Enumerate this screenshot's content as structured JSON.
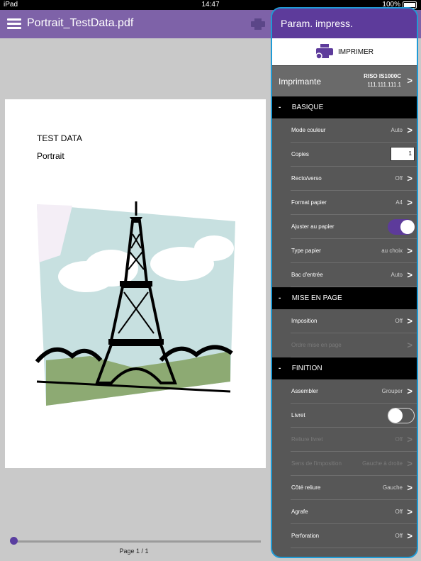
{
  "statusbar": {
    "device": "iPad",
    "time": "14:47",
    "battery": "100%"
  },
  "topbar": {
    "doc_title": "Portrait_TestData.pdf"
  },
  "viewer": {
    "line1": "TEST DATA",
    "line2": "Portrait",
    "page_count": "Page 1 / 1"
  },
  "panel": {
    "title": "Param. impress.",
    "print_label": "IMPRIMER",
    "printer": {
      "label": "Imprimante",
      "model": "RISO IS1000C",
      "ip": "111.111.111.1"
    },
    "sections": {
      "basic": "BASIQUE",
      "layout": "MISE EN PAGE",
      "finishing": "FINITION"
    },
    "rows": {
      "color_mode": {
        "label": "Mode couleur",
        "value": "Auto"
      },
      "copies": {
        "label": "Copies",
        "value": "1"
      },
      "duplex": {
        "label": "Recto/verso",
        "value": "Off"
      },
      "paper_size": {
        "label": "Format papier",
        "value": "A4"
      },
      "fit": {
        "label": "Ajuster au papier"
      },
      "paper_type": {
        "label": "Type papier",
        "value": "au choix"
      },
      "input_tray": {
        "label": "Bac d'entrée",
        "value": "Auto"
      },
      "imposition": {
        "label": "Imposition",
        "value": "Off"
      },
      "page_order": {
        "label": "Ordre mise en page"
      },
      "collate": {
        "label": "Assembler",
        "value": "Grouper"
      },
      "booklet": {
        "label": "Livret"
      },
      "booklet_binding": {
        "label": "Reliure livret",
        "value": "Off"
      },
      "imposition_direction": {
        "label": "Sens de l'imposition",
        "value": "Gauche à droite"
      },
      "binding_edge": {
        "label": "Côté reliure",
        "value": "Gauche"
      },
      "staple": {
        "label": "Agrafe",
        "value": "Off"
      },
      "punch": {
        "label": "Perforation",
        "value": "Off"
      }
    }
  }
}
